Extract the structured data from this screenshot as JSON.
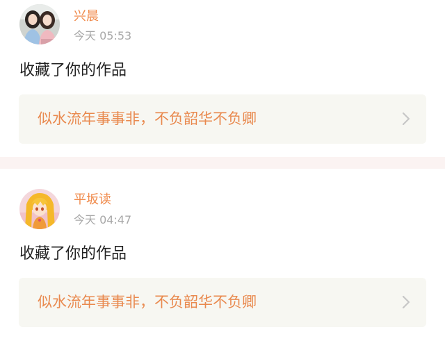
{
  "notifications": [
    {
      "username": "兴晨",
      "time": "今天 05:53",
      "action": "收藏了你的作品",
      "work_title": "似水流年事事非，不负韶华不负卿",
      "avatar_icon": "two-girls-photo-avatar"
    },
    {
      "username": "平坂读",
      "time": "今天 04:47",
      "action": "收藏了你的作品",
      "work_title": "似水流年事事非，不负韶华不负卿",
      "avatar_icon": "anime-character-avatar"
    }
  ],
  "colors": {
    "username": "#f08a4b",
    "work_title": "#e9894e",
    "card_bg": "#f7f7f2",
    "separator": "#fbf3f2",
    "timestamp": "#a8a8a8",
    "action_text": "#222222",
    "chevron": "#c6c6c6"
  }
}
